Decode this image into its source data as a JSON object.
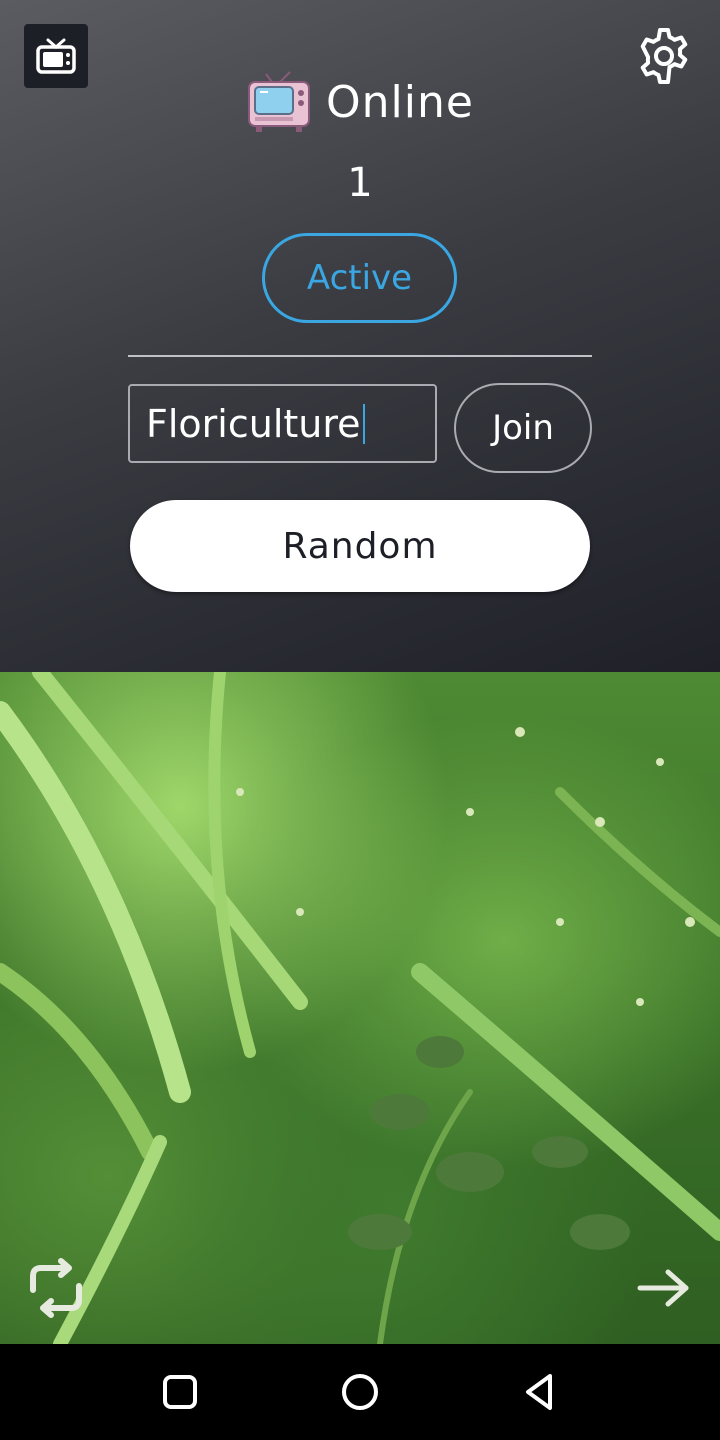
{
  "header": {
    "online_label": "Online",
    "online_count": "1",
    "status_label": "Active"
  },
  "room": {
    "input_value": "Floriculture",
    "join_label": "Join"
  },
  "random_label": "Random",
  "icons": {
    "tv": "tv-icon",
    "settings": "gear-icon",
    "online_badge": "retro-tv-icon",
    "rotate_camera": "rotate-camera-icon",
    "next": "arrow-right-icon",
    "nav_recents": "square-icon",
    "nav_home": "circle-icon",
    "nav_back": "triangle-back-icon"
  },
  "colors": {
    "accent": "#3aa6e2",
    "panel_dark": "#1d1f26",
    "text_light": "#ffffff"
  }
}
